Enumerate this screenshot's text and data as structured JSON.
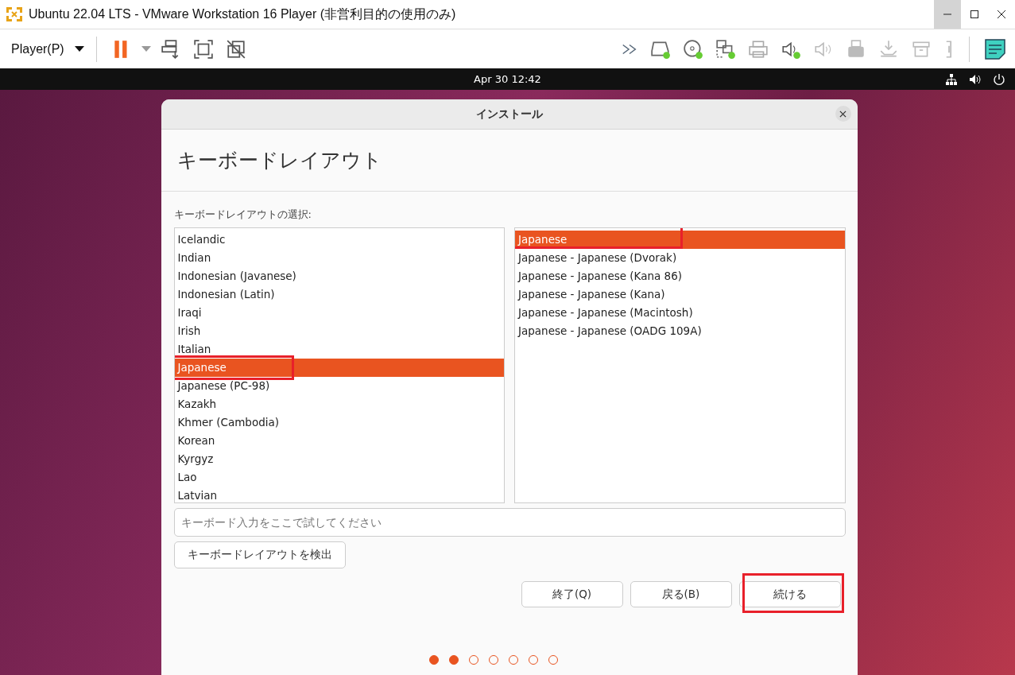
{
  "window": {
    "title": "Ubuntu 22.04 LTS - VMware Workstation 16 Player (非営利目的の使用のみ)"
  },
  "toolbar": {
    "player_menu": "Player(P)"
  },
  "guest_top_bar": {
    "clock": "Apr 30  12:42"
  },
  "dialog": {
    "title": "インストール",
    "heading": "キーボードレイアウト",
    "list_label": "キーボードレイアウトの選択:",
    "layouts": [
      {
        "label": "Icelandic",
        "selected": false,
        "highlighted": false
      },
      {
        "label": "Indian",
        "selected": false,
        "highlighted": false
      },
      {
        "label": "Indonesian (Javanese)",
        "selected": false,
        "highlighted": false
      },
      {
        "label": "Indonesian (Latin)",
        "selected": false,
        "highlighted": false
      },
      {
        "label": "Iraqi",
        "selected": false,
        "highlighted": false
      },
      {
        "label": "Irish",
        "selected": false,
        "highlighted": false
      },
      {
        "label": "Italian",
        "selected": false,
        "highlighted": false
      },
      {
        "label": "Japanese",
        "selected": true,
        "highlighted": true
      },
      {
        "label": "Japanese (PC-98)",
        "selected": false,
        "highlighted": false
      },
      {
        "label": "Kazakh",
        "selected": false,
        "highlighted": false
      },
      {
        "label": "Khmer (Cambodia)",
        "selected": false,
        "highlighted": false
      },
      {
        "label": "Korean",
        "selected": false,
        "highlighted": false
      },
      {
        "label": "Kyrgyz",
        "selected": false,
        "highlighted": false
      },
      {
        "label": "Lao",
        "selected": false,
        "highlighted": false
      },
      {
        "label": "Latvian",
        "selected": false,
        "highlighted": false
      }
    ],
    "variants": [
      {
        "label": "Japanese",
        "selected": true,
        "highlighted": true
      },
      {
        "label": "Japanese - Japanese (Dvorak)",
        "selected": false,
        "highlighted": false
      },
      {
        "label": "Japanese - Japanese (Kana 86)",
        "selected": false,
        "highlighted": false
      },
      {
        "label": "Japanese - Japanese (Kana)",
        "selected": false,
        "highlighted": false
      },
      {
        "label": "Japanese - Japanese (Macintosh)",
        "selected": false,
        "highlighted": false
      },
      {
        "label": "Japanese - Japanese (OADG 109A)",
        "selected": false,
        "highlighted": false
      }
    ],
    "test_field": {
      "placeholder": "キーボード入力をここで試してください"
    },
    "detect_button": "キーボードレイアウトを検出",
    "buttons": [
      {
        "label": "終了(Q)",
        "highlighted": false
      },
      {
        "label": "戻る(B)",
        "highlighted": false
      },
      {
        "label": "続ける",
        "highlighted": true
      }
    ],
    "progress_dots": [
      {
        "filled": true
      },
      {
        "filled": true
      },
      {
        "filled": false
      },
      {
        "filled": false
      },
      {
        "filled": false
      },
      {
        "filled": false
      },
      {
        "filled": false
      }
    ]
  }
}
